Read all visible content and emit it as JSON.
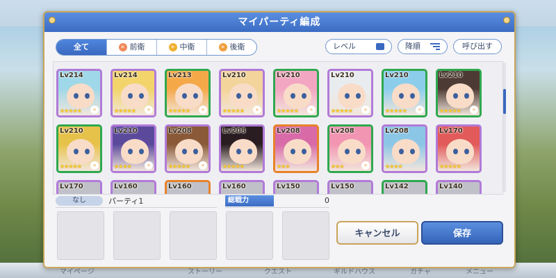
{
  "background": {
    "bottom_nav": [
      "マイページ",
      "ストーリー",
      "クエスト",
      "ギルドハウス",
      "ガチャ",
      "メニュー"
    ]
  },
  "dialog": {
    "title": "マイパーティ編成",
    "tabs": [
      {
        "label": "全て",
        "selected": true
      },
      {
        "label": "前衛",
        "selected": false
      },
      {
        "label": "中衛",
        "selected": false
      },
      {
        "label": "後衛",
        "selected": false
      }
    ],
    "sort_level_label": "レベル",
    "sort_order_label": "降順",
    "call_label": "呼び出す",
    "colors": {
      "accent": "#3b6cc4",
      "frame_gold": "#c8a65a",
      "purple_frame": "#b17ad8",
      "green_frame": "#2fa84f",
      "orange_frame": "#e8822a"
    },
    "characters": [
      {
        "level": "Lv214",
        "stars": "★★★★★",
        "frame": "purple",
        "hair": "#9fd8e8",
        "rank": true
      },
      {
        "level": "Lv214",
        "stars": "★★★★★",
        "frame": "purple",
        "hair": "#f2d46a",
        "rank": true
      },
      {
        "level": "Lv213",
        "stars": "★★★★★",
        "frame": "green",
        "hair": "#f5a848",
        "rank": true
      },
      {
        "level": "Lv210",
        "stars": "★★★★★",
        "frame": "purple",
        "hair": "#f3d49a",
        "rank": true
      },
      {
        "level": "Lv210",
        "stars": "★★★★★",
        "frame": "green",
        "hair": "#f3a6c2",
        "rank": true
      },
      {
        "level": "Lv210",
        "stars": "★★★★★",
        "frame": "purple",
        "hair": "#e9ecef",
        "rank": true
      },
      {
        "level": "Lv210",
        "stars": "★★★★★",
        "frame": "green",
        "hair": "#8ccdec",
        "rank": true
      },
      {
        "level": "Lv210",
        "stars": "★★★★★",
        "frame": "green",
        "hair": "#4e3a34",
        "rank": true
      },
      {
        "level": "Lv210",
        "stars": "★★★★★",
        "frame": "green",
        "hair": "#e7c24a",
        "rank": true
      },
      {
        "level": "Lv210",
        "stars": "★★★★",
        "frame": "purple",
        "hair": "#5b4a9c",
        "rank": true
      },
      {
        "level": "Lv208",
        "stars": "★★★★★",
        "frame": "purple",
        "hair": "#8a5a38",
        "rank": true
      },
      {
        "level": "Lv208",
        "stars": "★★★★★",
        "frame": "purple",
        "hair": "#2a1d22",
        "rank": false
      },
      {
        "level": "Lv208",
        "stars": "★★★",
        "frame": "orange",
        "hair": "#d86aa8",
        "rank": false
      },
      {
        "level": "Lv208",
        "stars": "★★★",
        "frame": "green",
        "hair": "#f295b2",
        "rank": true
      },
      {
        "level": "Lv208",
        "stars": "★★★★",
        "frame": "purple",
        "hair": "#8cc6e6",
        "rank": false
      },
      {
        "level": "Lv170",
        "stars": "★★★★★",
        "frame": "purple",
        "hair": "#e25a5a",
        "rank": false
      },
      {
        "level": "Lv170",
        "stars": "",
        "frame": "purple",
        "hair": "#c0c0c8",
        "rank": false
      },
      {
        "level": "Lv160",
        "stars": "",
        "frame": "purple",
        "hair": "#c0c0c8",
        "rank": false
      },
      {
        "level": "Lv160",
        "stars": "",
        "frame": "orange",
        "hair": "#c0c0c8",
        "rank": false
      },
      {
        "level": "Lv160",
        "stars": "",
        "frame": "purple",
        "hair": "#c0c0c8",
        "rank": false
      },
      {
        "level": "Lv150",
        "stars": "",
        "frame": "purple",
        "hair": "#c0c0c8",
        "rank": false
      },
      {
        "level": "Lv150",
        "stars": "",
        "frame": "purple",
        "hair": "#c0c0c8",
        "rank": false
      },
      {
        "level": "Lv142",
        "stars": "",
        "frame": "green",
        "hair": "#c0c0c8",
        "rank": false
      },
      {
        "level": "Lv140",
        "stars": "",
        "frame": "purple",
        "hair": "#c0c0c8",
        "rank": false
      }
    ],
    "party": {
      "badge": "なし",
      "name": "パーティ1",
      "power_label": "総戦力",
      "power_value": "0",
      "slots": 5
    },
    "buttons": {
      "cancel": "キャンセル",
      "save": "保存"
    }
  }
}
